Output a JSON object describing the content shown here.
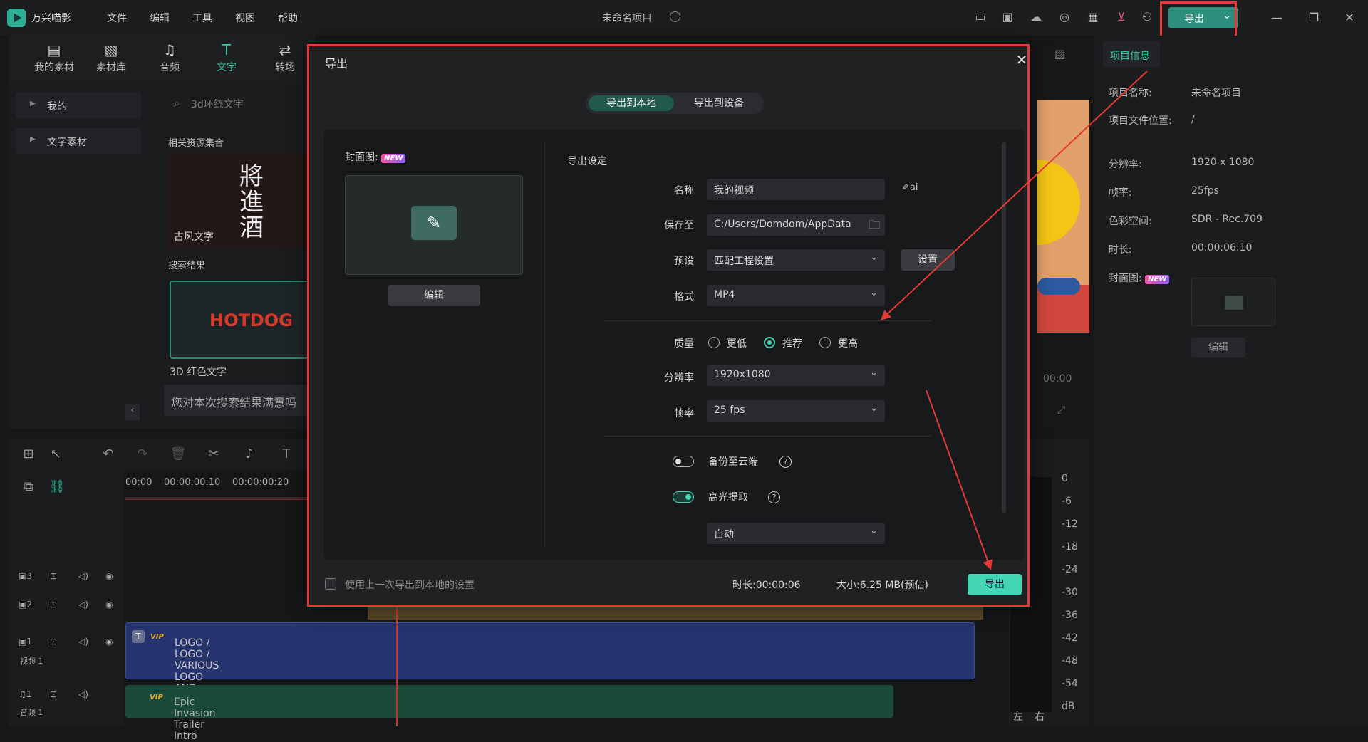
{
  "app": {
    "name": "万兴喵影",
    "menu": [
      "文件",
      "编辑",
      "工具",
      "视图",
      "帮助"
    ],
    "project_title": "未命名项目",
    "export_label": "导出"
  },
  "media_tabs": [
    {
      "label": "我的素材",
      "icon": "folder-image-icon"
    },
    {
      "label": "素材库",
      "icon": "cloud-library-icon"
    },
    {
      "label": "音频",
      "icon": "music-note-icon"
    },
    {
      "label": "文字",
      "icon": "text-t-icon"
    },
    {
      "label": "转场",
      "icon": "transition-icon"
    }
  ],
  "media_side": [
    "我的",
    "文字素材"
  ],
  "media_search_placeholder": "3d环绕文字",
  "media_sections": {
    "related": "相关资源集合",
    "results": "搜索结果"
  },
  "media_items": [
    {
      "label": "古风文字",
      "art": "將進酒"
    },
    {
      "label": "3D 红色文字",
      "art": "HOTDOG"
    }
  ],
  "feedback_text": "您对本次搜索结果满意吗",
  "project_info": {
    "tab": "项目信息",
    "fields": [
      {
        "k": "项目名称:",
        "v": "未命名项目"
      },
      {
        "k": "项目文件位置:",
        "v": "/"
      },
      {
        "k": "分辨率:",
        "v": "1920 x 1080"
      },
      {
        "k": "帧率:",
        "v": "25fps"
      },
      {
        "k": "色彩空间:",
        "v": "SDR - Rec.709"
      },
      {
        "k": "时长:",
        "v": "00:00:06:10"
      }
    ],
    "cover_label": "封面图:",
    "edit_label": "编辑"
  },
  "new_badge": "NEW",
  "vip_badge": "VIP",
  "timeline": {
    "ruler": [
      "00:00",
      "00:00:00:10",
      "00:00:00:20"
    ],
    "tracks": [
      {
        "num": "3",
        "label": ""
      },
      {
        "num": "2",
        "label": ""
      },
      {
        "num": "1",
        "label": "视频 1"
      },
      {
        "num": "1",
        "label": "音频 1"
      }
    ],
    "video_clip": "LOGO / LOGO / VARIOUS LOGO AND TEXT OPENER",
    "audio_clip": "Epic Invasion Trailer Intro",
    "preview_time": "00:00",
    "meter_scale": [
      "0",
      "-6",
      "-12",
      "-18",
      "-24",
      "-30",
      "-36",
      "-42",
      "-48",
      "-54",
      "dB"
    ],
    "meter_channels": [
      "左",
      "右"
    ]
  },
  "dialog": {
    "title": "导出",
    "tabs": [
      "导出到本地",
      "导出到设备"
    ],
    "cover_label": "封面图:",
    "cover_edit": "编辑",
    "settings_title": "导出设定",
    "name_label": "名称",
    "name_value": "我的视频",
    "save_label": "保存至",
    "save_value": "C:/Users/Domdom/AppData",
    "preset_label": "预设",
    "preset_value": "匹配工程设置",
    "settings_button": "设置",
    "format_label": "格式",
    "format_value": "MP4",
    "quality_label": "质量",
    "quality_options": [
      "更低",
      "推荐",
      "更高"
    ],
    "quality_selected": "推荐",
    "resolution_label": "分辨率",
    "resolution_value": "1920x1080",
    "fps_label": "帧率",
    "fps_value": "25 fps",
    "backup_label": "备份至云端",
    "backup_on": false,
    "highlight_label": "高光提取",
    "highlight_on": true,
    "highlight_mode": "自动",
    "reuse_label": "使用上一次导出到本地的设置",
    "duration_text": "时长:00:00:06",
    "size_text": "大小:6.25 MB(预估)",
    "export_button": "导出"
  },
  "colors": {
    "accent": "#43d6b5",
    "annotation_red": "#e53935"
  }
}
